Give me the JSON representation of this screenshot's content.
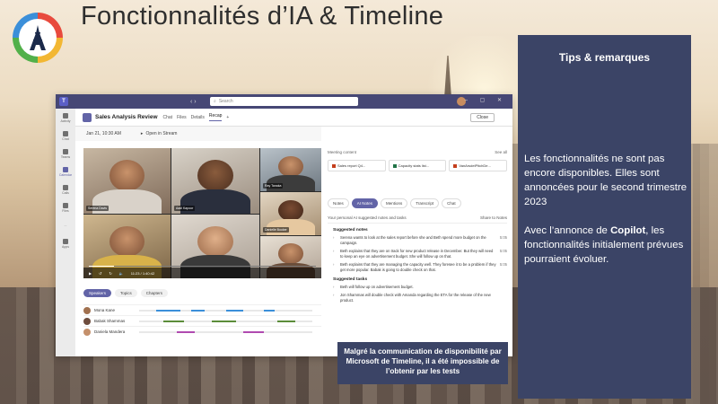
{
  "slide": {
    "title": "Fonctionnalités d’IA & Timeline",
    "logo_icon": "eiffel-tower-icon"
  },
  "teams": {
    "search_placeholder": "Search",
    "rail": [
      "Activity",
      "Chat",
      "Teams",
      "Calendar",
      "Calls",
      "Files",
      "...",
      "Apps"
    ],
    "meeting_title": "Sales Analysis Review",
    "tabs": [
      "Chat",
      "Files",
      "Details",
      "Recap"
    ],
    "active_tab": "Recap",
    "close_label": "Close",
    "date": "Jan 21, 10:30 AM",
    "open_stream": "Open in Stream",
    "participants": [
      "Serena Davis",
      "Aadi Kapoor",
      "Ray Tanaka",
      "Danielle Booker"
    ],
    "video_time": "11:23 / 1:40:42",
    "progress": 0.11,
    "chips": [
      "Speakers",
      "Topics",
      "Chapters"
    ],
    "speakers": [
      {
        "name": "Mona Kane"
      },
      {
        "name": "Babak Shammas"
      },
      {
        "name": "Daniela Mandera"
      }
    ],
    "meeting_content": "Meeting content",
    "see_all": "See all",
    "files": [
      "Sales report Q4...",
      "Capacity stats list...",
      "VanArsdelPitchDe..."
    ],
    "right_tabs": [
      "Notes",
      "AI Notes",
      "Mentions",
      "Transcript",
      "Chat"
    ],
    "active_right_tab": "AI Notes",
    "ai_subtitle": "Your personal AI suggested notes and tasks",
    "share_notes": "Share to Notes",
    "suggested_notes_title": "Suggested notes",
    "notes": [
      {
        "text": "Serena wants to look at the sales report before she and Beth spend more budget on the campaign.",
        "time": "5:05"
      },
      {
        "text": "Beth explains that they are on track for new product release in December. But they will need to keep an eye on advertisement budget. She will follow up on that.",
        "time": "5:05"
      },
      {
        "text": "Beth explains that they are managing the capacity well. They foresee it to be a problem if they get more popular. Babak is going to double check on that.",
        "time": "5:05"
      }
    ],
    "suggested_tasks_title": "Suggested tasks",
    "tasks": [
      {
        "text": "Beth will follow up on advertisement budget."
      },
      {
        "text": "Jon Shammas will double check with Amanda regarding the ETA for the release of the new product."
      }
    ]
  },
  "caption": {
    "text": "Malgré la communication de disponibilité par Microsoft de Timeline, il a été impossible de l’obtenir par les tests"
  },
  "tips": {
    "title": "Tips & remarques",
    "p1": "Les fonctionnalités ne sont pas encore disponibles. Elles sont annoncées pour le second trimestre 2023",
    "p2_prefix": "Avec l’annonce de ",
    "p2_bold": "Copilot",
    "p2_suffix": ", les fonctionnalités initialement prévues pourraient évoluer."
  },
  "colors": {
    "panel": "#3b4466",
    "teams_purple": "#6264a7"
  }
}
